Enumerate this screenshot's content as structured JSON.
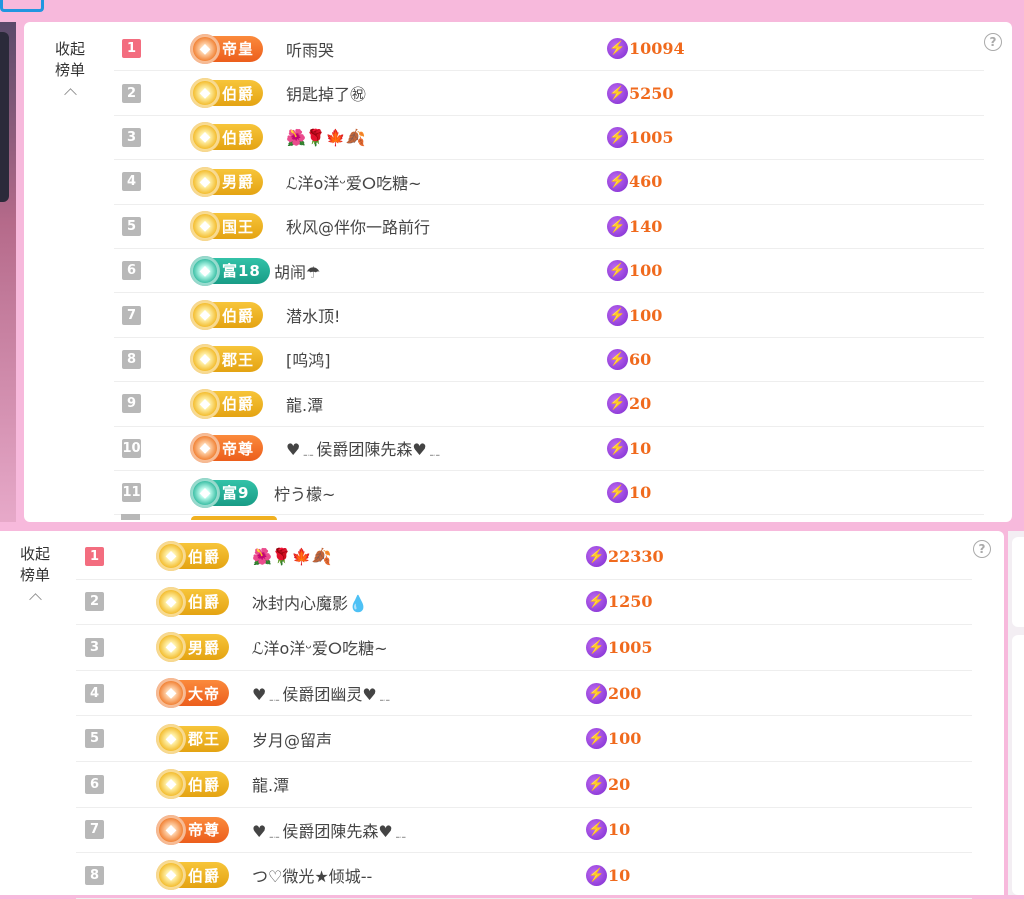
{
  "icons": {
    "help": "?",
    "bolt": "⚡",
    "gem": "◆"
  },
  "colors": {
    "gold": "#e4a312",
    "orange": "#ec5e1c",
    "teal": "#189c86",
    "score": "#f06a1d",
    "rank_first": "#f36d7f"
  },
  "panel1": {
    "collapse_line1": "收起",
    "collapse_line2": "榜单",
    "help_label": "?",
    "rows": [
      {
        "rank": "1",
        "badge": "帝皇",
        "badge_style": "orange",
        "name": "听雨哭",
        "score": "10094"
      },
      {
        "rank": "2",
        "badge": "伯爵",
        "badge_style": "gold",
        "name": "钥匙掉了㊗",
        "score": "5250"
      },
      {
        "rank": "3",
        "badge": "伯爵",
        "badge_style": "gold",
        "name": "🌺🌹🍁🍂",
        "score": "1005"
      },
      {
        "rank": "4",
        "badge": "男爵",
        "badge_style": "gold",
        "name": "ℒ洋o洋ᵕ爱ⵔ吃糖~",
        "score": "460"
      },
      {
        "rank": "5",
        "badge": "国王",
        "badge_style": "gold",
        "name": "秋风@伴你一路前行",
        "score": "140"
      },
      {
        "rank": "6",
        "badge": "富18",
        "badge_style": "teal",
        "name": "胡闹☂",
        "score": "100"
      },
      {
        "rank": "7",
        "badge": "伯爵",
        "badge_style": "gold",
        "name": "潜水顶!",
        "score": "100"
      },
      {
        "rank": "8",
        "badge": "郡王",
        "badge_style": "gold",
        "name": "[呜鸿]",
        "score": "60"
      },
      {
        "rank": "9",
        "badge": "伯爵",
        "badge_style": "gold",
        "name": "龍.潭",
        "score": "20"
      },
      {
        "rank": "10",
        "badge": "帝尊",
        "badge_style": "orange",
        "name": "♥﹎侯爵团陳先森♥﹎",
        "score": "10"
      },
      {
        "rank": "11",
        "badge": "富9",
        "badge_style": "teal",
        "name": "柠う檬~",
        "score": "10"
      }
    ]
  },
  "panel2": {
    "collapse_line1": "收起",
    "collapse_line2": "榜单",
    "help_label": "?",
    "rows": [
      {
        "rank": "1",
        "badge": "伯爵",
        "badge_style": "gold",
        "name": "🌺🌹🍁🍂",
        "score": "22330"
      },
      {
        "rank": "2",
        "badge": "伯爵",
        "badge_style": "gold",
        "name": "冰封内心魔影💧",
        "score": "1250"
      },
      {
        "rank": "3",
        "badge": "男爵",
        "badge_style": "gold",
        "name": "ℒ洋o洋ᵕ爱ⵔ吃糖~",
        "score": "1005"
      },
      {
        "rank": "4",
        "badge": "大帝",
        "badge_style": "orange",
        "name": "♥﹎侯爵团幽灵♥﹎",
        "score": "200"
      },
      {
        "rank": "5",
        "badge": "郡王",
        "badge_style": "gold",
        "name": "岁月@留声",
        "score": "100"
      },
      {
        "rank": "6",
        "badge": "伯爵",
        "badge_style": "gold",
        "name": "龍.潭",
        "score": "20"
      },
      {
        "rank": "7",
        "badge": "帝尊",
        "badge_style": "orange",
        "name": "♥﹎侯爵团陳先森♥﹎",
        "score": "10"
      },
      {
        "rank": "8",
        "badge": "伯爵",
        "badge_style": "gold",
        "name": "つ♡微光★倾城--",
        "score": "10"
      }
    ]
  }
}
